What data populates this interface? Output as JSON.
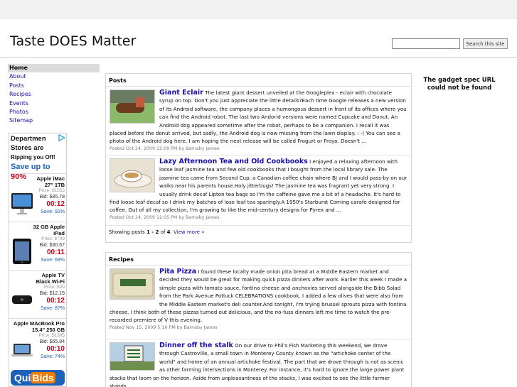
{
  "site": {
    "title": "Taste DOES Matter"
  },
  "search": {
    "placeholder": "",
    "button_label": "Search this site"
  },
  "sidebar": {
    "items": [
      {
        "label": "Home",
        "active": true
      },
      {
        "label": "About"
      },
      {
        "label": "Posts"
      },
      {
        "label": "Recipes"
      },
      {
        "label": "Events"
      },
      {
        "label": "Photos"
      },
      {
        "label": "Sitemap"
      }
    ]
  },
  "ad": {
    "headline_1": "Departmen",
    "headline_2": "Stores are",
    "headline_3": "Ripping you Off!",
    "save_text": "Save up to ",
    "save_pct": "90%",
    "items": [
      {
        "name": "Apple iMac",
        "name2": "27\" 1TB",
        "price": "Price: $1553",
        "bid": "Bid: $85.78",
        "timer": "00:12",
        "save": "Save: 92%"
      },
      {
        "name": "32 GB Apple",
        "name2": "iPad",
        "price": "Price: $799",
        "bid": "Bid: $30.67",
        "timer": "00:11",
        "save": "Save: 68%"
      },
      {
        "name": "Apple TV",
        "name2": "Black Wi-Fi",
        "price": "Price: $99",
        "bid": "Bid: $12.15",
        "timer": "00:12",
        "save": "Save: 87%"
      },
      {
        "name": "Apple MAcBook Pro",
        "name2": "15.4\" 250 GB",
        "price": "Price: $1385",
        "bid": "Bid: $65.84",
        "timer": "00:10",
        "save": "Save: 74%"
      }
    ],
    "logo_1": "Qui",
    "logo_2": "Bids"
  },
  "posts": {
    "heading": "Posts",
    "entries": [
      {
        "title": "Giant Eclair",
        "body": " The latest giant dessert unveiled at the Googleplex - eclair with chocolate syrup on top. Don't you just appreciate the little details?Each time Google releases a new version of its Android software, the company places a humongous dessert in front of its offices where you can find the Android robot. The last two Andorid versions were named Cupcake and Donut. An Android dog appeared sometime after the robot, perhaps to be a companion. I recall it was placed before the donut arrived, but sadly, the Android dog is now missing from the lawn display. : -( You can see a photo of the Android dog here. I am hoping the next release will be called Frogurt or Froyo. Doesn't ...",
        "meta": "Posted Oct 24, 2009 12:09 PM by Barnaby James"
      },
      {
        "title": "Lazy Afternoon Tea and Old Cookbooks",
        "body": " I enjoyed a relaxing afternoon with loose leaf jasmine tea and few old cookbooks that I bought from the local library sale. The jasmine tea came from Second Cup, a Canadian coffee chain where BJ and I would pass-by on our walks near his parents house.Holy jitterbugs! The jasmine tea was fragrant yet very strong. I usually drink decaf Lipton tea bags so I'm the caffeine gave me a bit of a headache. It's hard to find loose leaf decaf so I drink my batches of lose leaf tea sparingly.A 1950's Starburst Corning carafe designed for coffee. Out of all my collection, I'm growing to like the mid-century designs for Pyrex and ...",
        "meta": "Posted Oct 24, 2009 12:05 PM by Barnaby James"
      }
    ],
    "footer_prefix": "Showing posts ",
    "footer_range": "1 - 2",
    "footer_of": " of ",
    "footer_total": "4",
    "footer_link": "View more »"
  },
  "recipes": {
    "heading": "Recipes",
    "entries": [
      {
        "title": "Pita Pizza",
        "body": " I found these locally made onion pita bread at a Middle Eastern market and decided they would be great for making quick pizza dinners after work. Earlier this week I made a simple pizza with tomato sauce, fontina cheese and anchovies served alongside the Bibb Salad from the Park Avenue Potluck CELEBRATIONS  cookbook. I added a few olives that were also from the Middle Eastern market's deli counter.And tonight, I'm trying brussel sprouts pizza with fontina cheese. I think both of these pizzas turned out delicious, and the no-fuss dinners left me time to watch the pre-recorded premiere of V this evening.",
        "meta": "Posted Nov 15, 2009 5:10 PM by Barnaby James"
      },
      {
        "title": "Dinner off the stalk",
        "body": " On our drive to Phil's Fish Marketing this weekend, we drove through Castroville, a small town in Monterey County known as the \"artichoke center of the world\" and home of an annual artichoke festival. The part that we drove through is not as scenic as other farming intersections in Monterey. For instance, it's hard to ignore the large power plant stacks that loom on the horizon. Aside from unpleasantness of the stacks, I was excited to see the little farmer stands",
        "meta": ""
      }
    ]
  },
  "gadget": {
    "message": "The gadget spec URL could not be found"
  }
}
